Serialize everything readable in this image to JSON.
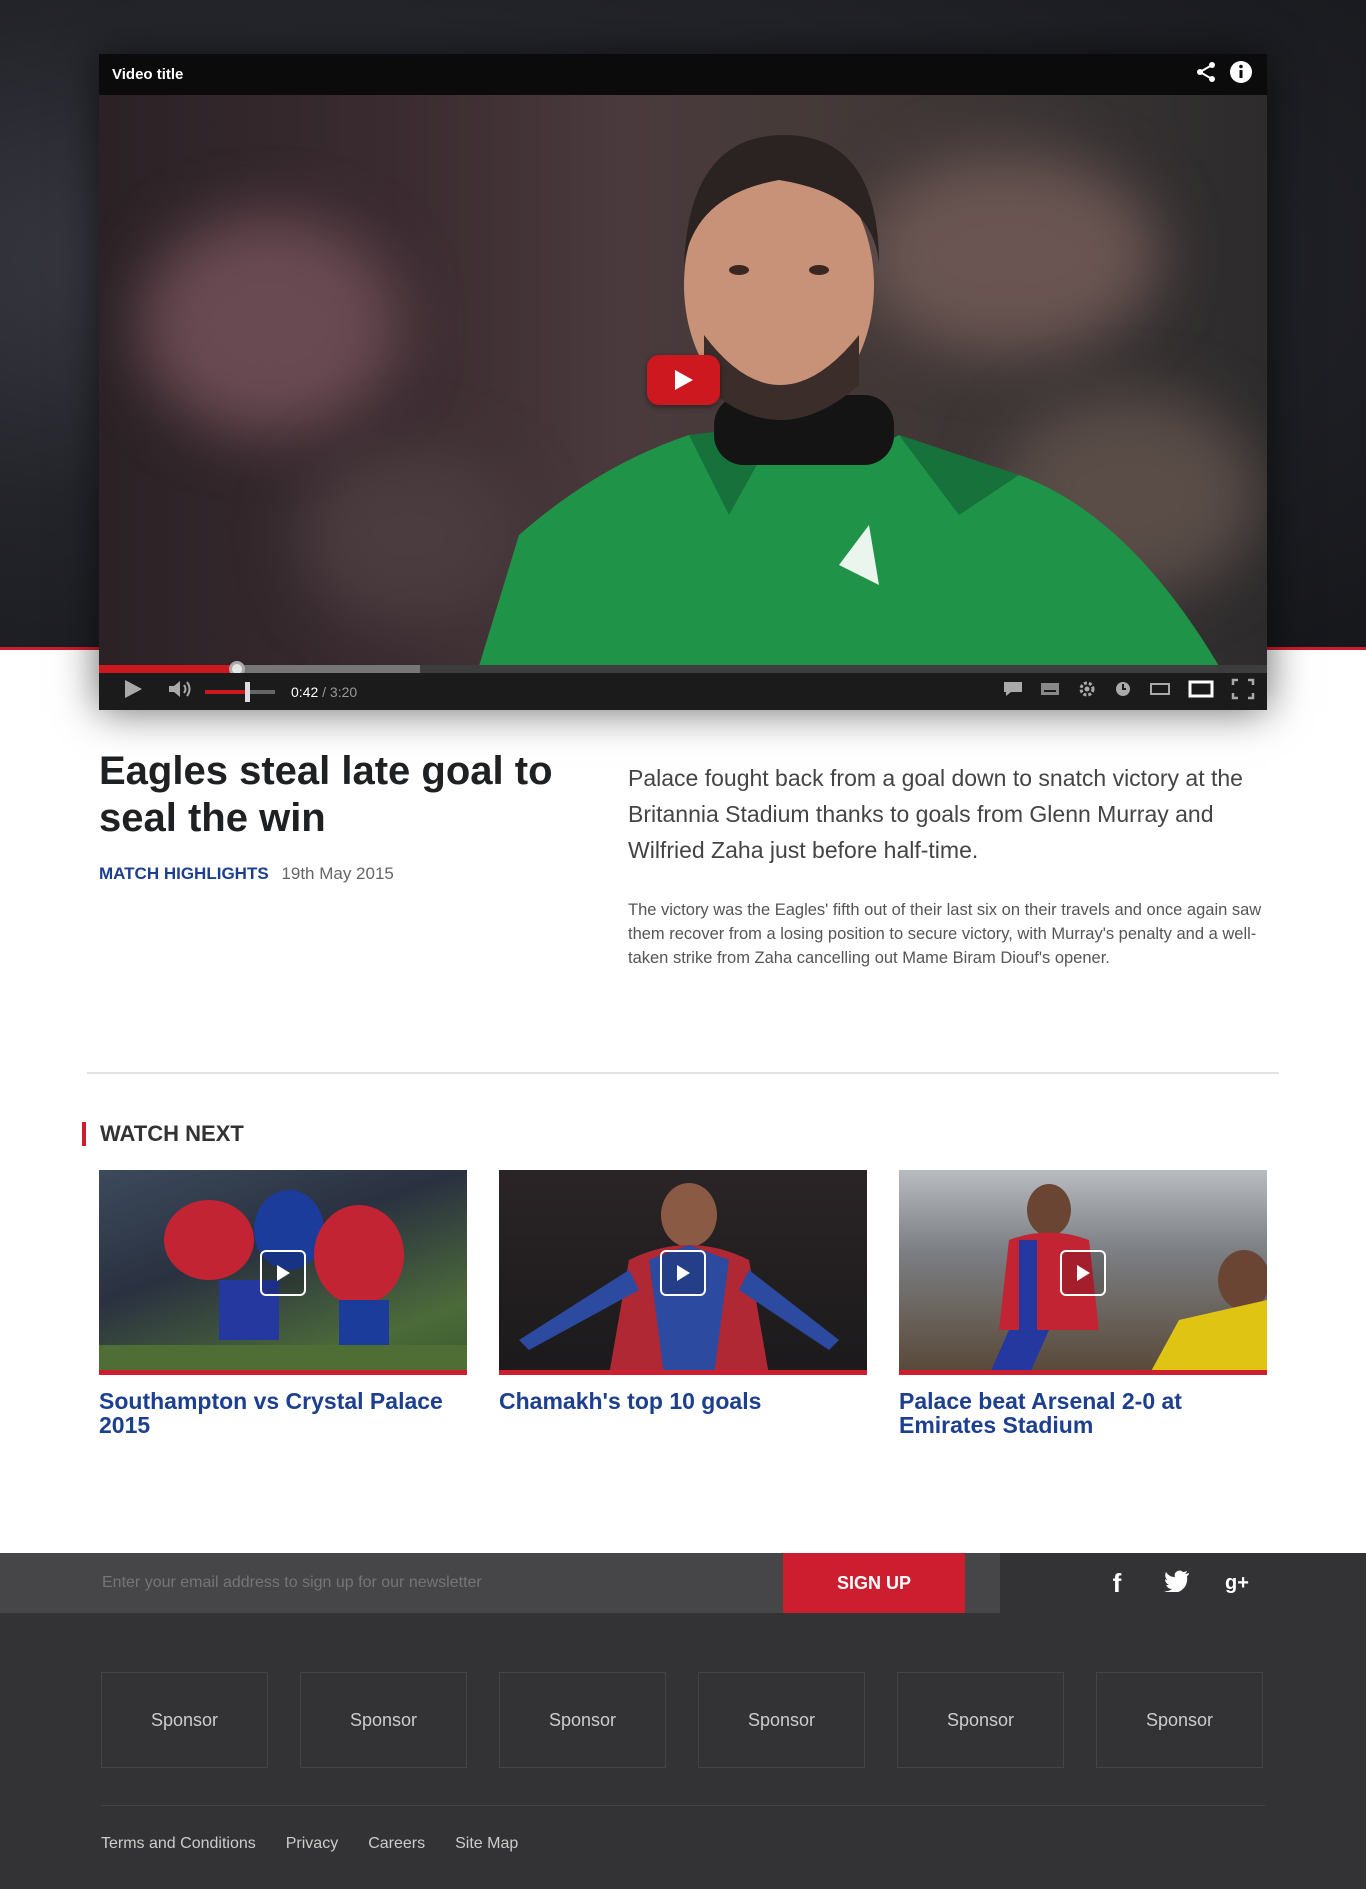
{
  "player": {
    "title": "Video title",
    "current_time": "0:42",
    "duration": "/ 3:20",
    "progress_played": 0.118,
    "progress_loaded": 0.275,
    "volume": 0.6
  },
  "article": {
    "headline": "Eagles steal late goal to seal the win",
    "category": "MATCH HIGHLIGHTS",
    "date": "19th May 2015",
    "lede": "Palace fought back from a goal down to snatch victory at the Britannia Stadium thanks to goals from Glenn Murray and Wilfried Zaha just before half-time.",
    "body": "The victory was the Eagles' fifth out of their last six on their travels and once again saw them recover from a losing position to secure victory, with Murray's penalty and a well-taken strike from Zaha cancelling out Mame Biram Diouf's opener."
  },
  "watch_next": {
    "title": "WATCH NEXT",
    "items": [
      {
        "title": "Southampton vs Crystal Palace 2015"
      },
      {
        "title": "Chamakh's top 10 goals"
      },
      {
        "title": "Palace beat Arsenal 2-0 at Emirates Stadium"
      }
    ]
  },
  "footer": {
    "newsletter_placeholder": "Enter your email address to sign up for our newsletter",
    "signup_label": "SIGN UP",
    "social": [
      "f",
      "🐦",
      "g+"
    ],
    "sponsors": [
      "Sponsor",
      "Sponsor",
      "Sponsor",
      "Sponsor",
      "Sponsor",
      "Sponsor"
    ],
    "links": [
      "Terms and Conditions",
      "Privacy",
      "Careers",
      "Site Map"
    ]
  },
  "colors": {
    "accent_red": "#cc1e2f",
    "link_blue": "#1d3f8f",
    "footer_bg": "#333335"
  }
}
